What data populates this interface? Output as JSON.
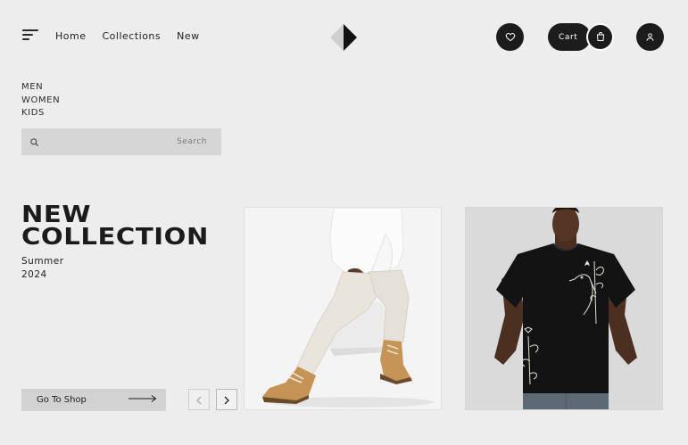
{
  "header": {
    "nav": [
      "Home",
      "Collections",
      "New"
    ],
    "cart_label": "Cart"
  },
  "categories": [
    "MEN",
    "WOMEN",
    "KIDS"
  ],
  "search": {
    "label": "Search",
    "value": ""
  },
  "hero": {
    "title_line1": "NEW",
    "title_line2": "COLLECTION",
    "season": "Summer",
    "year": "2024"
  },
  "cta": {
    "label": "Go To Shop"
  },
  "icons": {
    "menu": "hamburger-menu-icon",
    "logo": "diamond-play-logo",
    "favorite": "heart-icon",
    "cart": "shopping-bag-icon",
    "user": "user-icon",
    "search": "search-icon",
    "arrow_right": "long-arrow-right-icon",
    "prev": "chevron-left-icon",
    "next": "chevron-right-icon"
  },
  "products": [
    {
      "name": "model-white-outfit-photo"
    },
    {
      "name": "model-black-tshirt-photo"
    }
  ],
  "colors": {
    "background": "#ededed",
    "dark": "#1c1c1c",
    "search_bg": "#d6d6d6",
    "button_bg": "#d2d2d2"
  }
}
